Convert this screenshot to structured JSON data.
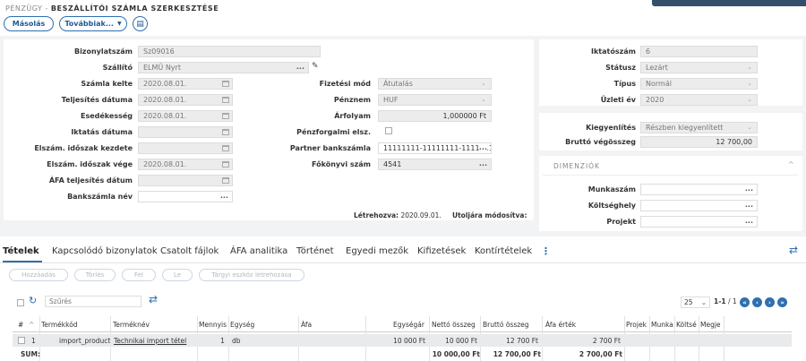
{
  "header": {
    "module": "PÉNZÜGY - ",
    "title": "BESZÁLLÍTÓI SZÁMLA SZERKESZTÉSE",
    "copy_label": "Másolás",
    "more_label": "Továbbiak...",
    "more_icon": "chevron-down-icon",
    "clipboard_icon": "clipboard-icon"
  },
  "form_left": {
    "bizonylatszam": {
      "label": "Bizonylatszám",
      "value": "Sz09016"
    },
    "szallito": {
      "label": "Szállító",
      "value": "ELMŰ Nyrt"
    },
    "szamla_kelte": {
      "label": "Számla kelte",
      "value": "2020.08.01."
    },
    "teljesites_datuma": {
      "label": "Teljesítés dátuma",
      "value": "2020.08.01."
    },
    "esedekesseg": {
      "label": "Esedékesség",
      "value": "2020.08.01."
    },
    "iktatas_datuma": {
      "label": "Iktatás dátuma",
      "value": ""
    },
    "elszam_kezdete": {
      "label": "Elszám. időszak kezdete",
      "value": ""
    },
    "elszam_vege": {
      "label": "Elszám. időszak vége",
      "value": "2020.08.01."
    },
    "afa_teljesites": {
      "label": "ÁFA teljesítés dátum",
      "value": ""
    },
    "bankszamla_nev": {
      "label": "Bankszámla név",
      "value": ""
    }
  },
  "form_mid": {
    "fizetesi_mod": {
      "label": "Fizetési mód",
      "value": "Átutalás"
    },
    "penznem": {
      "label": "Pénznem",
      "value": "HUF"
    },
    "arfolyam": {
      "label": "Árfolyam",
      "value": "1,000000 Ft"
    },
    "penzforgalmi": {
      "label": "Pénzforgalmi elsz.",
      "checked": false
    },
    "partner_bankszamla": {
      "label": "Partner bankszámla",
      "value": "11111111-11111111-11111111"
    },
    "fokonyvi_szam": {
      "label": "Főkönyvi szám",
      "value": "4541"
    }
  },
  "footer_info": {
    "letrehozva_label": "Létrehozva:",
    "letrehozva_value": "2020.09.01.",
    "utoljara_label": "Utoljára módosítva:"
  },
  "form_right": {
    "iktatoszam": {
      "label": "Iktatószám",
      "value": "6"
    },
    "statusz": {
      "label": "Státusz",
      "value": "Lezárt"
    },
    "tipus": {
      "label": "Típus",
      "value": "Normál"
    },
    "uzleti_ev": {
      "label": "Üzleti év",
      "value": "2020"
    },
    "kiegyenlites": {
      "label": "Kiegyenlítés",
      "value": "Részben kiegyenlített"
    },
    "brutto_vegosszeg": {
      "label": "Bruttó végösszeg",
      "value": "12 700,00"
    }
  },
  "dimenziok": {
    "title": "DIMENZIÓK",
    "munkaszam": {
      "label": "Munkaszám",
      "value": ""
    },
    "koltseghely": {
      "label": "Költséghely",
      "value": ""
    },
    "projekt": {
      "label": "Projekt",
      "value": ""
    }
  },
  "tabs": [
    "Tételek",
    "Kapcsolódó bizonylatok",
    "Csatolt fájlok",
    "ÁFA analitika",
    "Történet",
    "Egyedi mezők",
    "Kifizetések",
    "Kontírtételek"
  ],
  "actions": [
    "Hozzáadás",
    "Törlés",
    "Fel",
    "Le",
    "Tárgyi eszköz létrehozása"
  ],
  "filter": {
    "placeholder": "Szűrés"
  },
  "pagination": {
    "page_size": "25",
    "range": "1-1",
    "total": "/ 1"
  },
  "columns": [
    "#",
    "Termékkód",
    "Terméknév",
    "Mennyis",
    "Egység",
    "Áfa",
    "Egységár",
    "Nettó összeg",
    "Bruttó összeg",
    "Áfa érték",
    "Projek",
    "Munka",
    "Költsé",
    "Megje"
  ],
  "rows": [
    {
      "n": "1",
      "kod": "import_product",
      "nev": "Technikai import tétel",
      "menny": "1",
      "egyseg": "db",
      "afa": "",
      "egysegar": "10 000 Ft",
      "netto": "10 000 Ft",
      "brutto": "12 700 Ft",
      "afa_ertek": "2 700 Ft"
    }
  ],
  "sum_row": {
    "label": "SUM:",
    "netto": "10 000,00 Ft",
    "brutto": "12 700,00 Ft",
    "afa_ertek": "2 700,00 Ft"
  },
  "colors": {
    "accent": "#2f6fb0",
    "panel_bg": "#f2f3f4",
    "field_bg": "#ececec"
  }
}
